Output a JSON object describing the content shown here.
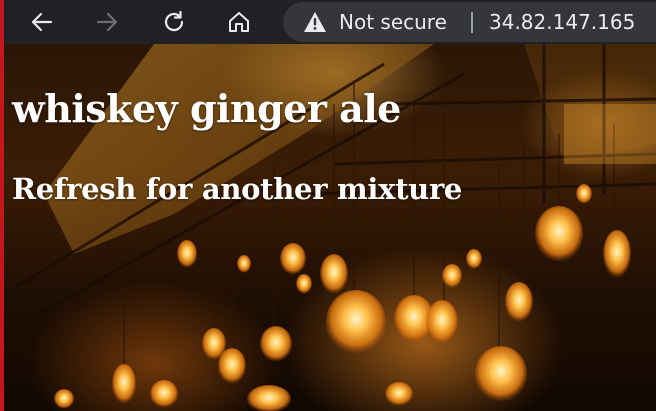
{
  "browser": {
    "security_status": "Not secure",
    "url": "34.82.147.165",
    "icons": {
      "back": "arrow-left-icon",
      "forward": "arrow-right-icon",
      "reload": "reload-icon",
      "home": "home-icon",
      "warning": "warning-triangle-icon"
    }
  },
  "page": {
    "drink": "whiskey ginger ale",
    "subtitle": "Refresh for another mixture",
    "background": "bar-with-edison-bulbs-photo"
  },
  "colors": {
    "toolbar": "#202124",
    "address_bar": "#35363a",
    "text": "#ffffff",
    "accent_edge": "#c4161c"
  }
}
